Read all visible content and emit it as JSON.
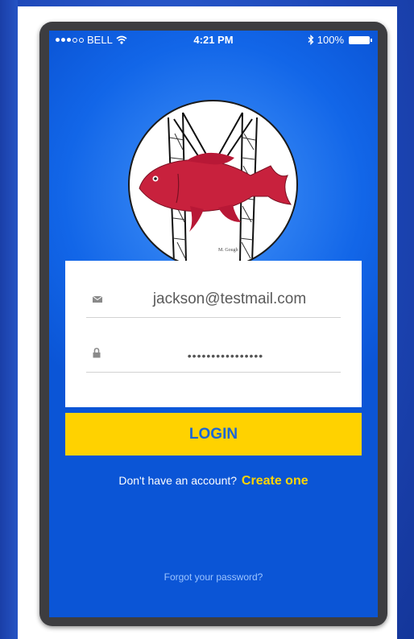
{
  "status_bar": {
    "carrier": "BELL",
    "time": "4:21 PM",
    "battery": "100%",
    "signal_bars_filled": 3,
    "signal_bars_total": 5
  },
  "logo": {
    "description_icon": "fish-logo-icon",
    "signature": "M. Gough"
  },
  "login_form": {
    "email_value": "jackson@testmail.com",
    "email_icon": "mail-icon",
    "password_value": "••••••••••••••••",
    "password_icon": "lock-icon"
  },
  "actions": {
    "login_label": "LOGIN",
    "signup_prompt": "Don't have an account?",
    "signup_link": "Create one",
    "forgot_link": "Forgot your password?"
  },
  "colors": {
    "screen_blue": "#1266e8",
    "button_yellow": "#ffd200",
    "button_text": "#1b66d6",
    "link_yellow": "#ffd500"
  }
}
